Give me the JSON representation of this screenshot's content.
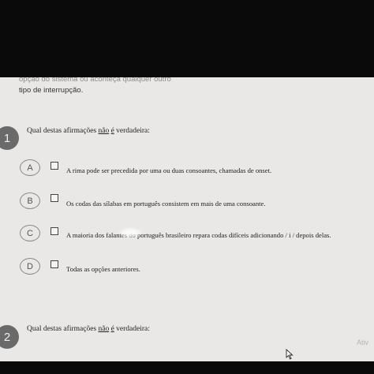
{
  "intro": {
    "line1": "opção do sistema ou aconteça qualquer outro",
    "line2": "tipo de interrupção."
  },
  "questions": [
    {
      "number": "1",
      "text_before": "Qual destas afirmações ",
      "text_u1": "não",
      "text_u2": "é",
      "text_after": " verdadeira:",
      "options": [
        {
          "letter": "A",
          "text": "A rima pode ser precedida por uma ou duas consoantes, chamadas de onset."
        },
        {
          "letter": "B",
          "text": "Os codas das sílabas em português consistem em mais de uma consoante."
        },
        {
          "letter": "C",
          "text": "A maioria dos falantes do português brasileiro repara codas difíceis adicionando / i / depois delas."
        },
        {
          "letter": "D",
          "text": "Todas as opções anteriores."
        }
      ]
    },
    {
      "number": "2",
      "text_before": "Qual destas afirmações ",
      "text_u1": "não",
      "text_u2": "é",
      "text_after": " verdadeira:"
    }
  ],
  "watermark": "Ativ",
  "icons": {
    "cursor": "mouse-pointer-icon"
  },
  "colors": {
    "background": "#e9e8e6",
    "badge": "#6a6a6a"
  }
}
